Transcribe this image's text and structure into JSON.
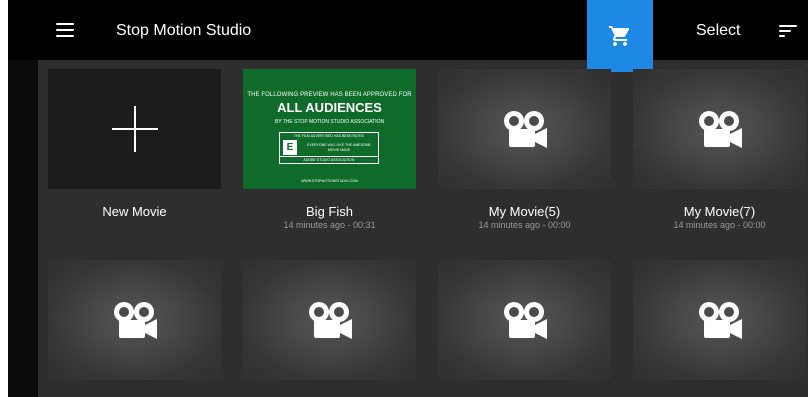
{
  "app": {
    "title": "Stop Motion Studio",
    "select_label": "Select",
    "accent_color": "#1e88e5",
    "icons": [
      "hamburger-menu-icon",
      "shopping-cart-icon",
      "sort-icon",
      "plus-icon",
      "film-camera-icon"
    ]
  },
  "new_movie": {
    "label": "New Movie"
  },
  "featured": {
    "title": "Big Fish",
    "subtitle": "14 minutes ago - 00:31",
    "rating_line1": "THE FOLLOWING PREVIEW HAS BEEN APPROVED FOR",
    "rating_line2": "ALL AUDIENCES",
    "rating_line3": "BY THE STOP MOTION STUDIO ASSOCIATION",
    "rating_box_top": "THE FILM ADVERTISED HAS BEEN RATED",
    "rating_letter": "E",
    "rating_desc": "EVERYONE WILL LIKE THE AWESOME MOVIE MADE",
    "rating_box_bottom": "ADOBE STUDIO ASSOCIATION",
    "rating_footer": "WWW.STOPMOTIONSTUDIO.COM"
  },
  "movies": [
    {
      "title": "My Movie(5)",
      "subtitle": "14 minutes ago - 00:00"
    },
    {
      "title": "My Movie(7)",
      "subtitle": "14 minutes ago - 00:00"
    }
  ]
}
